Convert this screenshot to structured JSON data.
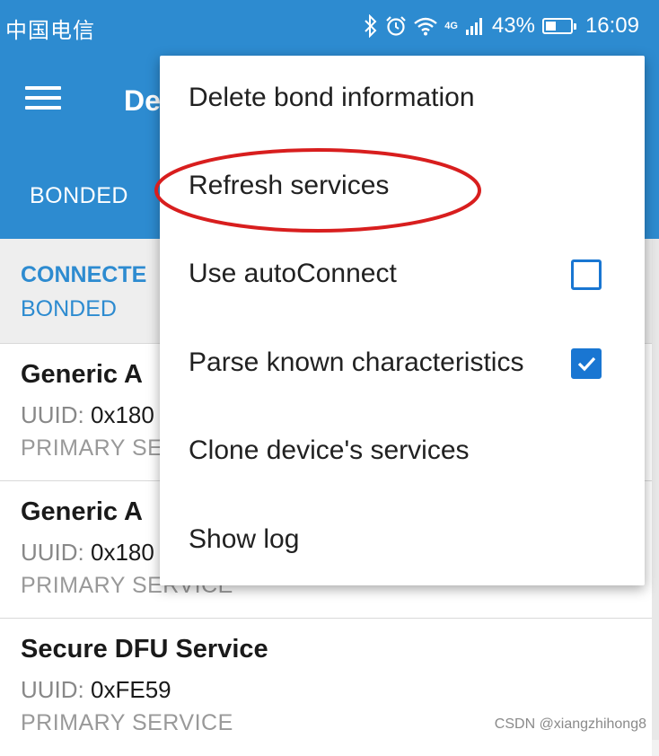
{
  "status_bar": {
    "carrier": "中国电信",
    "network": "4G",
    "battery_percent": "43%",
    "battery_level": 0.43,
    "time": "16:09",
    "icons": [
      "bluetooth-icon",
      "alarm-icon",
      "wifi-icon",
      "signal-icon",
      "battery-icon"
    ]
  },
  "app_bar": {
    "title": "De",
    "tab": "BONDED",
    "color": "#2d8bd0"
  },
  "device": {
    "connection_state": "CONNECTE",
    "bond_state": "BONDED"
  },
  "services": [
    {
      "name": "Generic A",
      "uuid_label": "UUID:",
      "uuid": "0x180",
      "type": "PRIMARY SE"
    },
    {
      "name": "Generic A",
      "uuid_label": "UUID:",
      "uuid": "0x180",
      "type": "PRIMARY SERVICE"
    },
    {
      "name": "Secure DFU Service",
      "uuid_label": "UUID:",
      "uuid": "0xFE59",
      "type": "PRIMARY SERVICE"
    }
  ],
  "menu": {
    "items": [
      {
        "label": "Delete bond information"
      },
      {
        "label": "Refresh services"
      },
      {
        "label": "Use autoConnect",
        "checked": false
      },
      {
        "label": "Parse known characteristics",
        "checked": true
      },
      {
        "label": "Clone device's services"
      },
      {
        "label": "Show log"
      }
    ],
    "checkbox_color": "#1976d2",
    "highlight_color": "#d81e1e"
  },
  "watermark": "CSDN @xiangzhihong8"
}
